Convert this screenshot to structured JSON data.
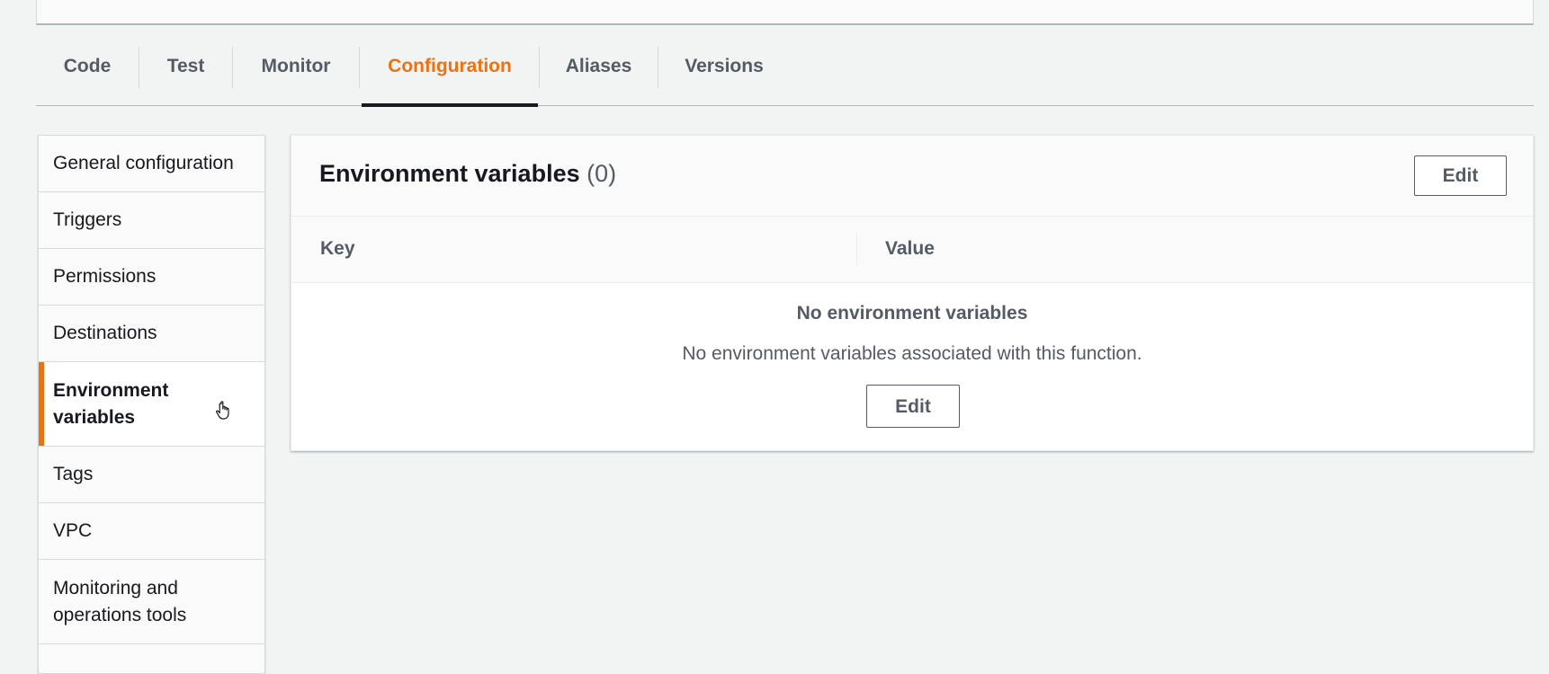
{
  "tabs": [
    {
      "label": "Code"
    },
    {
      "label": "Test"
    },
    {
      "label": "Monitor"
    },
    {
      "label": "Configuration"
    },
    {
      "label": "Aliases"
    },
    {
      "label": "Versions"
    }
  ],
  "active_tab": "Configuration",
  "sidebar": {
    "items": [
      {
        "label": "General configuration"
      },
      {
        "label": "Triggers"
      },
      {
        "label": "Permissions"
      },
      {
        "label": "Destinations"
      },
      {
        "label": "Environment variables"
      },
      {
        "label": "Tags"
      },
      {
        "label": "VPC"
      },
      {
        "label": "Monitoring and operations tools"
      }
    ],
    "active": "Environment variables"
  },
  "panel": {
    "title": "Environment variables",
    "count": "(0)",
    "edit_label": "Edit",
    "columns": {
      "key": "Key",
      "value": "Value"
    },
    "empty_title": "No environment variables",
    "empty_description": "No environment variables associated with this function.",
    "empty_edit_label": "Edit"
  },
  "colors": {
    "accent": "#ec7211",
    "text": "#16191f",
    "muted": "#545b64",
    "background": "#f2f3f3"
  }
}
